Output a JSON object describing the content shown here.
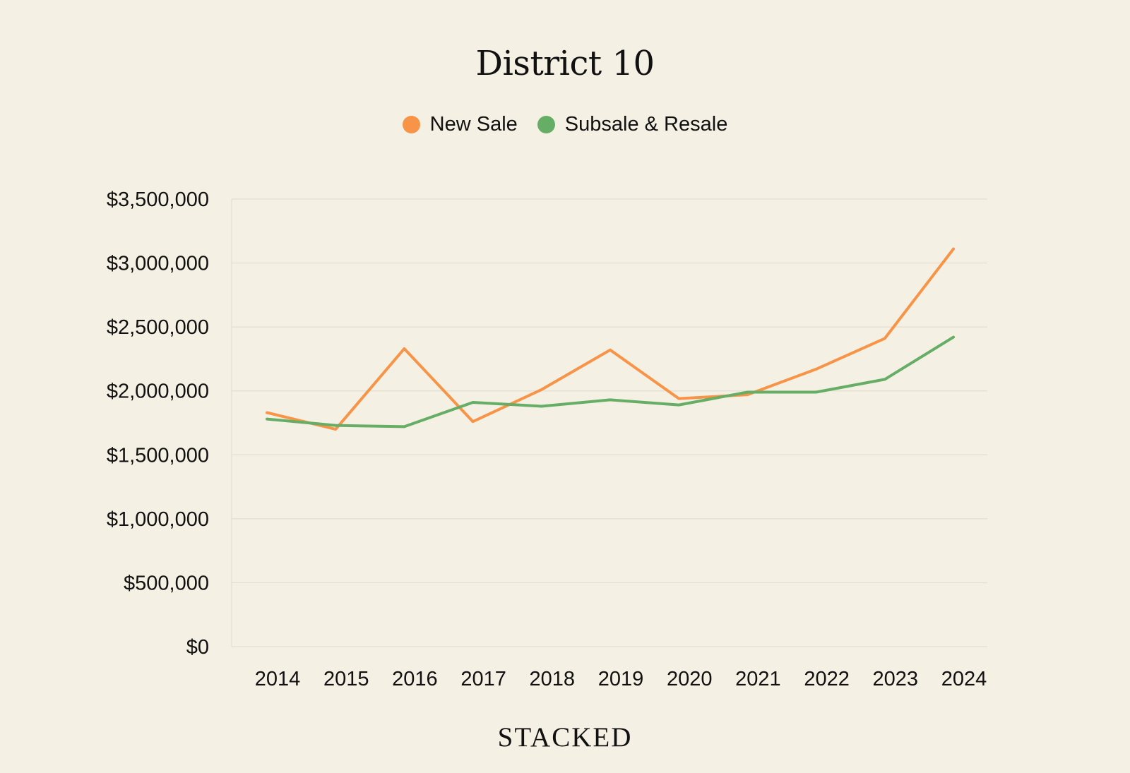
{
  "chart_data": {
    "type": "line",
    "title": "District 10",
    "xlabel": "",
    "ylabel": "",
    "categories": [
      "2014",
      "2015",
      "2016",
      "2017",
      "2018",
      "2019",
      "2020",
      "2021",
      "2022",
      "2023",
      "2024"
    ],
    "series": [
      {
        "name": "New Sale",
        "color": "#f79448",
        "values": [
          1830000,
          1700000,
          2330000,
          1760000,
          2010000,
          2320000,
          1940000,
          1970000,
          2170000,
          2410000,
          3110000
        ]
      },
      {
        "name": "Subsale & Resale",
        "color": "#66ad66",
        "values": [
          1780000,
          1730000,
          1720000,
          1910000,
          1880000,
          1930000,
          1890000,
          1990000,
          1990000,
          2090000,
          2420000
        ]
      }
    ],
    "ylim": [
      0,
      3500000
    ],
    "yticks": [
      "$0",
      "$500,000",
      "$1,000,000",
      "$1,500,000",
      "$2,000,000",
      "$2,500,000",
      "$3,000,000",
      "$3,500,000"
    ],
    "ytick_values": [
      0,
      500000,
      1000000,
      1500000,
      2000000,
      2500000,
      3000000,
      3500000
    ],
    "grid": true,
    "legend_position": "top-center"
  },
  "branding": {
    "logo_text": "STACKED"
  }
}
